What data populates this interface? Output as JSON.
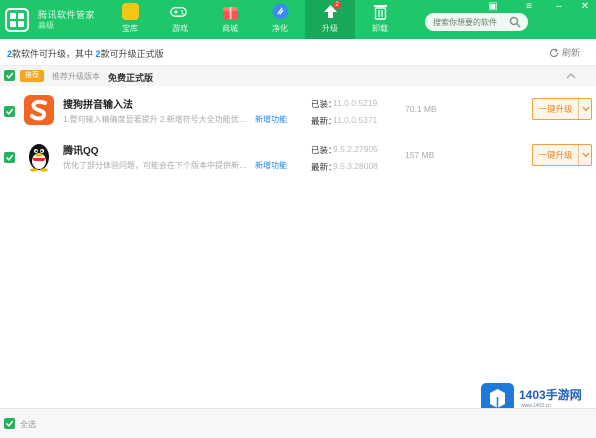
{
  "header": {
    "title": "腾讯软件管家",
    "subtitle": "高级",
    "nav": [
      {
        "label": "宝库",
        "icon": "treasure-icon",
        "color": "#f5c518",
        "active": false
      },
      {
        "label": "游戏",
        "icon": "gamepad-icon",
        "color": "#ffffff",
        "active": false
      },
      {
        "label": "商城",
        "icon": "gift-icon",
        "color": "#ff5252",
        "active": false
      },
      {
        "label": "净化",
        "icon": "shield-clean-icon",
        "color": "#3b8cf0",
        "active": false
      },
      {
        "label": "升级",
        "icon": "upgrade-arrow-icon",
        "color": "#ffffff",
        "active": true,
        "badge": "2"
      },
      {
        "label": "卸载",
        "icon": "trash-icon",
        "color": "#ffffff",
        "active": false
      }
    ],
    "search_placeholder": "搜索你想要的软件"
  },
  "summary": {
    "prefix": "",
    "count": "2",
    "middle": "款软件可升级，其中",
    "count2": "2",
    "suffix": "款可升级正式版",
    "refresh": "刷新"
  },
  "group": {
    "tag": "推荐",
    "name": "推荐升级版本",
    "label": "免费正式版"
  },
  "apps": [
    {
      "name": "搜狗拼音输入法",
      "desc": "1.整句输入精确度显著提升 2.新增符号大全功能优化，默...",
      "new_feature": "新增功能",
      "installed_label": "已装：",
      "installed": "11.0.0.5219",
      "latest_label": "最新：",
      "latest": "11.0.0.5371",
      "size": "70.1 MB",
      "button": "一键升级"
    },
    {
      "name": "腾讯QQ",
      "desc": "优化了部分体验问题，可能会在下个版本中提供新功能...",
      "new_feature": "新增功能",
      "installed_label": "已装：",
      "installed": "9.5.2.27905",
      "latest_label": "最新：",
      "latest": "9.5.3.28008",
      "size": "157 MB",
      "button": "一键升级"
    }
  ],
  "footer": {
    "select_all": "全选"
  },
  "watermark": {
    "brand": "1403手游网",
    "url": "www.1403.cn"
  },
  "colors": {
    "brand": "#1ec86a",
    "accent_orange": "#f0a040",
    "link_blue": "#1e88e5"
  }
}
